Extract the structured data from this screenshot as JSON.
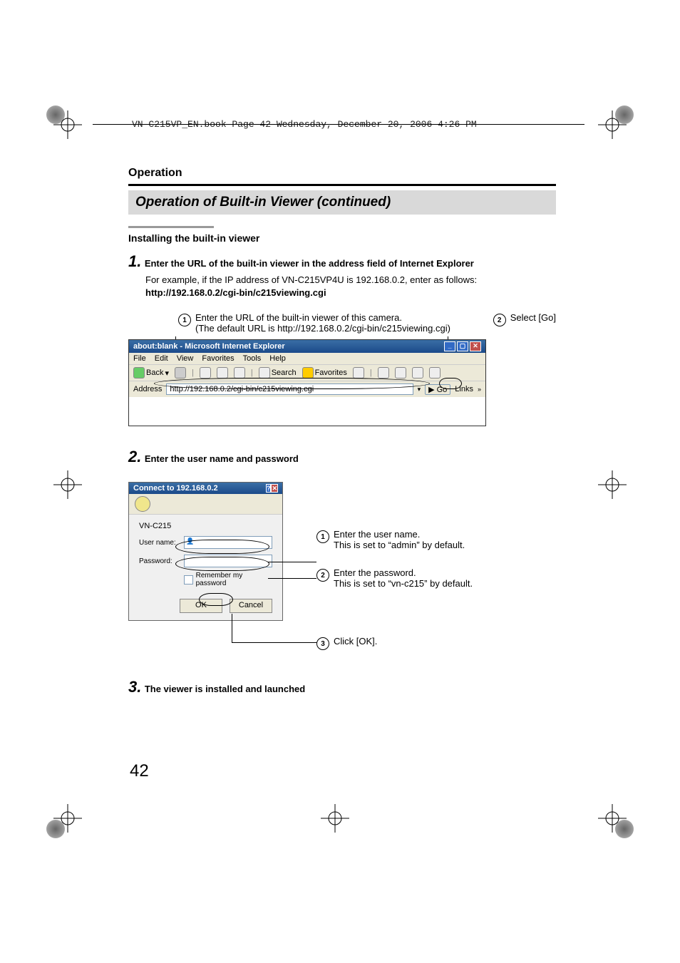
{
  "header_line": "VN-C215VP_EN.book  Page 42  Wednesday, December 20, 2006  4:26 PM",
  "section": "Operation",
  "title": "Operation of Built-in Viewer (continued)",
  "subtitle": "Installing the built-in viewer",
  "step1": {
    "num": "1.",
    "title": "Enter the URL of the built-in viewer in the address field of Internet Explorer",
    "body_prefix": "For example, if the IP address of VN-C215VP4U is 192.168.0.2, enter as follows:",
    "url_bold": "http://192.168.0.2/cgi-bin/c215viewing.cgi",
    "callout1_line1": "Enter the URL of the built-in viewer of this camera.",
    "callout1_line2": "(The default URL is http://192.168.0.2/cgi-bin/c215viewing.cgi)",
    "callout2": "Select [Go]"
  },
  "browser": {
    "title": "about:blank - Microsoft Internet Explorer",
    "menu": [
      "File",
      "Edit",
      "View",
      "Favorites",
      "Tools",
      "Help"
    ],
    "back": "Back",
    "search": "Search",
    "favorites": "Favorites",
    "addr_label": "Address",
    "url": "http://192.168.0.2/cgi-bin/c215viewing.cgi",
    "go": "Go",
    "links": "Links"
  },
  "step2": {
    "num": "2.",
    "title": "Enter the user name and password"
  },
  "login": {
    "title": "Connect to 192.168.0.2",
    "realm": "VN-C215",
    "user_label": "User name:",
    "pass_label": "Password:",
    "remember": "Remember my password",
    "ok": "OK",
    "cancel": "Cancel"
  },
  "login_annot": {
    "a1_l1": "Enter the user name.",
    "a1_l2": "This is set to “admin” by default.",
    "a2_l1": "Enter the password.",
    "a2_l2": "This is set to “vn-c215” by default.",
    "a3": "Click [OK]."
  },
  "step3": {
    "num": "3.",
    "title": "The viewer is installed and launched"
  },
  "page_number": "42"
}
